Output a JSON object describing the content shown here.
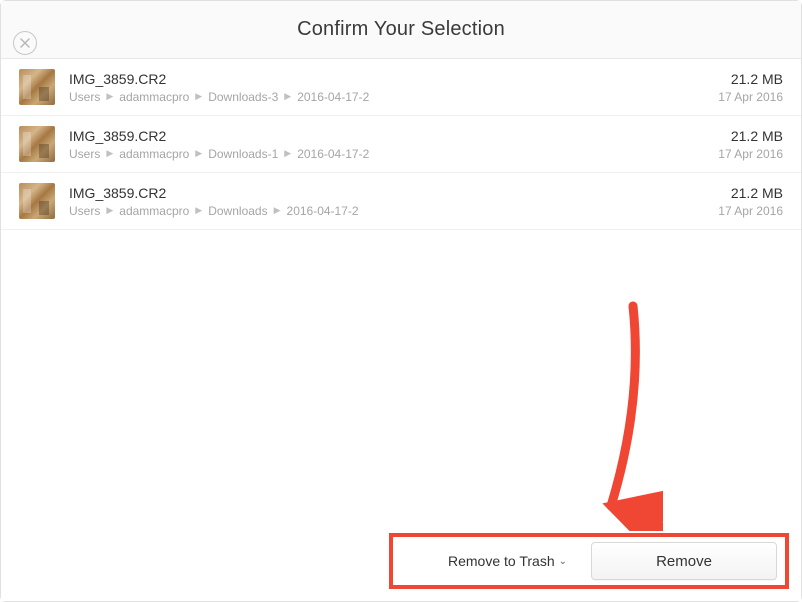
{
  "header": {
    "title": "Confirm Your Selection"
  },
  "files": [
    {
      "name": "IMG_3859.CR2",
      "path": [
        "Users",
        "adammacpro",
        "Downloads-3",
        "2016-04-17-2"
      ],
      "size": "21.2 MB",
      "date": "17 Apr 2016"
    },
    {
      "name": "IMG_3859.CR2",
      "path": [
        "Users",
        "adammacpro",
        "Downloads-1",
        "2016-04-17-2"
      ],
      "size": "21.2 MB",
      "date": "17 Apr 2016"
    },
    {
      "name": "IMG_3859.CR2",
      "path": [
        "Users",
        "adammacpro",
        "Downloads",
        "2016-04-17-2"
      ],
      "size": "21.2 MB",
      "date": "17 Apr 2016"
    }
  ],
  "footer": {
    "dropdown_label": "Remove to Trash",
    "remove_label": "Remove"
  },
  "annotation": {
    "color": "#f04634"
  }
}
